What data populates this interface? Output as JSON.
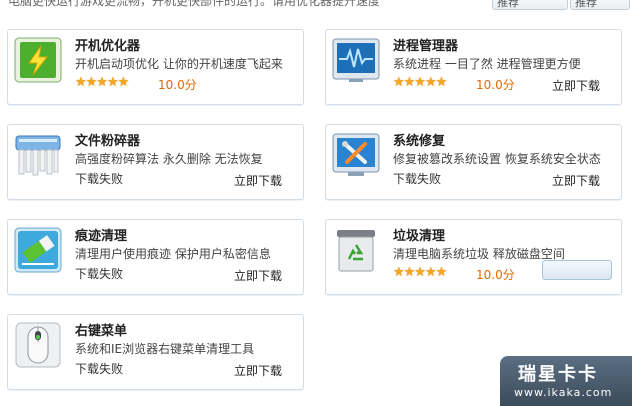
{
  "header": {
    "text": "电脑更快运行游戏更流畅，开机更快部件的运行。请用优化器提升速度",
    "btn1": "推荐",
    "btn2": "推荐"
  },
  "cards": [
    {
      "title": "开机优化器",
      "desc": "开机启动项优化  让你的开机速度飞起来",
      "stars": "★★★★★",
      "score": "10.0分",
      "icon": "power-icon"
    },
    {
      "title": "进程管理器",
      "desc": "系统进程  一目了然  进程管理更方便",
      "stars": "★★★★★",
      "score": "10.0分",
      "download": "立即下载",
      "icon": "monitor-wave-icon"
    },
    {
      "title": "文件粉碎器",
      "desc": "高强度粉碎算法  永久删除  无法恢复",
      "status": "下载失败",
      "download": "立即下载",
      "icon": "shredder-icon"
    },
    {
      "title": "系统修复",
      "desc": "修复被篡改系统设置  恢复系统安全状态",
      "status": "下载失败",
      "download": "立即下载",
      "icon": "repair-tools-icon"
    },
    {
      "title": "痕迹清理",
      "desc": "清理用户使用痕迹  保护用户私密信息",
      "status": "下载失败",
      "download": "立即下载",
      "icon": "eraser-icon"
    },
    {
      "title": "垃圾清理",
      "desc": "清理电脑系统垃圾  释放磁盘空间",
      "stars": "★★★★★",
      "score": "10.0分",
      "icon": "recycle-bin-icon",
      "progress": 0
    },
    {
      "title": "右键菜单",
      "desc": "系统和IE浏览器右键菜单清理工具",
      "status": "下载失败",
      "download": "立即下载",
      "icon": "mouse-icon"
    }
  ],
  "watermark": {
    "title": "瑞星卡卡",
    "url": "www.ikaka.com"
  },
  "colors": {
    "border": "#d4dde6",
    "star": "#f5a623",
    "score": "#e06a00"
  }
}
